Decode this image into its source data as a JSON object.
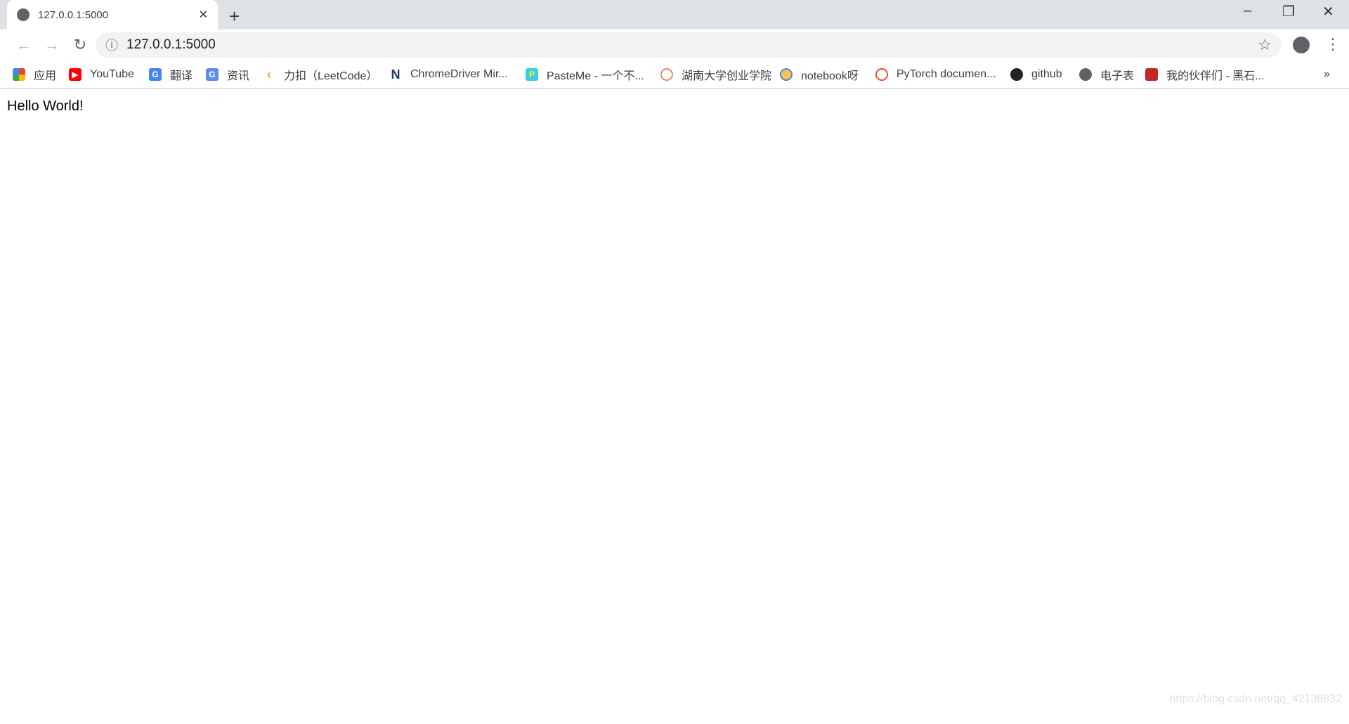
{
  "tab": {
    "title": "127.0.0.1:5000",
    "close": "✕",
    "new_tab": "+"
  },
  "window": {
    "minimize": "–",
    "restore": "❐",
    "close": "✕"
  },
  "toolbar": {
    "back": "←",
    "forward": "→",
    "reload": "↻",
    "url": "127.0.0.1:5000",
    "info": "ⓘ",
    "star": "☆",
    "menu": "⋮"
  },
  "bookmarks": [
    {
      "label": "应用",
      "icon": "apps-grid-icon"
    },
    {
      "label": "YouTube",
      "icon": "youtube-icon"
    },
    {
      "label": "翻译",
      "icon": "google-translate-icon"
    },
    {
      "label": "资讯",
      "icon": "news-icon"
    },
    {
      "label": "力扣（LeetCode）",
      "icon": "leetcode-icon"
    },
    {
      "label": "ChromeDriver Mir...",
      "icon": "n-logo-icon"
    },
    {
      "label": "PasteMe - 一个不...",
      "icon": "pasteme-icon"
    },
    {
      "label": "湖南大学创业学院",
      "icon": "university-seal-icon"
    },
    {
      "label": "notebook呀",
      "icon": "notebook-icon"
    },
    {
      "label": "PyTorch documen...",
      "icon": "pytorch-icon"
    },
    {
      "label": "github",
      "icon": "github-icon"
    },
    {
      "label": "电子表",
      "icon": "globe-icon"
    },
    {
      "label": "我的伙伴们 - 黑石...",
      "icon": "avatar-icon"
    }
  ],
  "bookmarks_overflow": "»",
  "page": {
    "text": "Hello World!"
  },
  "watermark": "https://blog.csdn.net/qq_42136832"
}
